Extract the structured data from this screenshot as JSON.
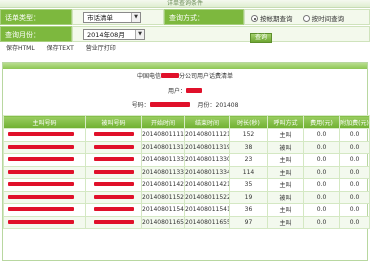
{
  "title_bar": "详单查询条件",
  "form": {
    "user_type_label": "话单类型：",
    "user_type_value": "市话清单",
    "query_mode_label": "查询方式：",
    "mode_option_1": "按帐期查询",
    "mode_option_2": "按时间查询",
    "query_month_label": "查询月份：",
    "query_month_value": "2014年08月",
    "query_button": "查询"
  },
  "actions": {
    "save_html": "保存HTML",
    "save_text": "保存TEXT",
    "print": "营业厅打印"
  },
  "bill": {
    "title_prefix": "中国电信",
    "title_suffix": "分公司用户话费清单",
    "user_label": "用户：",
    "number_label": "号码：",
    "month_label": "月份：",
    "month_value": "201408"
  },
  "table": {
    "headers": [
      "主叫号码",
      "被叫号码",
      "开始时间",
      "结束时间",
      "时长(秒)",
      "呼叫方式",
      "费用(元)",
      "附加费(元)"
    ],
    "rows": [
      {
        "start": "20140801111924",
        "end": "20140801112156",
        "duration": "152",
        "mode": "主叫",
        "fee": "0.0",
        "extra": "0.0"
      },
      {
        "start": "20140801131854",
        "end": "20140801131932",
        "duration": "38",
        "mode": "被叫",
        "fee": "0.0",
        "extra": "0.0"
      },
      {
        "start": "20140801133022",
        "end": "20140801133045",
        "duration": "23",
        "mode": "主叫",
        "fee": "0.0",
        "extra": "0.0"
      },
      {
        "start": "20140801133235",
        "end": "20140801133429",
        "duration": "114",
        "mode": "主叫",
        "fee": "0.0",
        "extra": "0.0"
      },
      {
        "start": "20140801142055",
        "end": "20140801142130",
        "duration": "35",
        "mode": "主叫",
        "fee": "0.0",
        "extra": "0.0"
      },
      {
        "start": "20140801152227",
        "end": "20140801152246",
        "duration": "19",
        "mode": "被叫",
        "fee": "0.0",
        "extra": "0.0"
      },
      {
        "start": "20140801154054",
        "end": "20140801154130",
        "duration": "36",
        "mode": "主叫",
        "fee": "0.0",
        "extra": "0.0"
      },
      {
        "start": "20140801165337",
        "end": "20140801165514",
        "duration": "97",
        "mode": "主叫",
        "fee": "0.0",
        "extra": "0.0"
      }
    ]
  },
  "colors": {
    "accent_green": "#7db83e",
    "redaction": "#e0102a"
  }
}
